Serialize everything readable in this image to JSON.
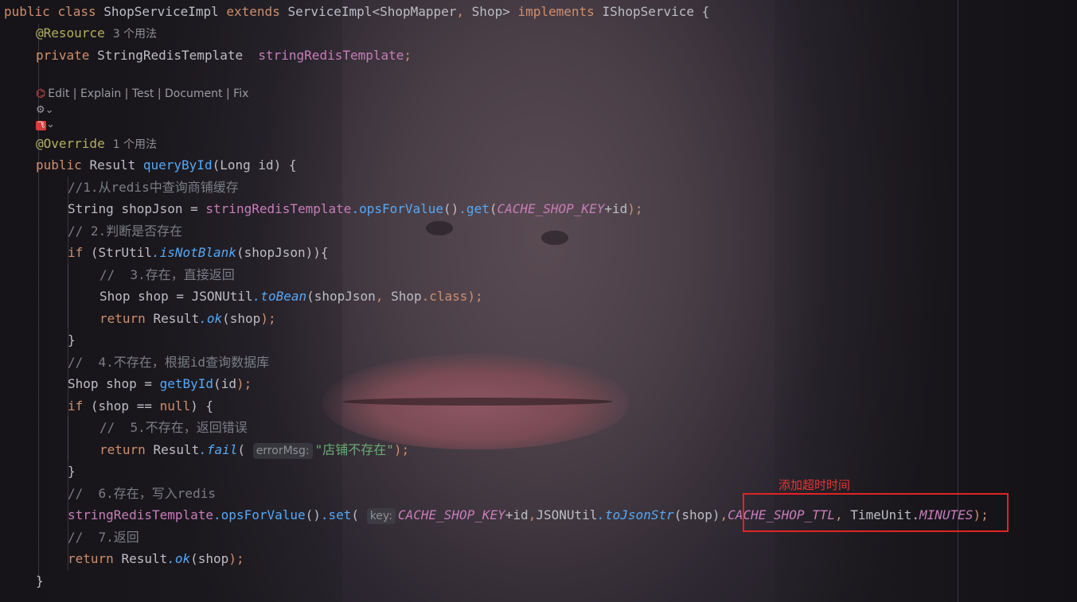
{
  "code": {
    "class_decl": {
      "kw1": "public",
      "kw2": "class",
      "name": "ShopServiceImpl",
      "kw3": "extends",
      "parent": "ServiceImpl",
      "lt": "<",
      "t1": "ShopMapper",
      "comma": ", ",
      "t2": "Shop",
      "gt": ">",
      "kw4": "implements",
      "iface": "IShopService",
      "brace": " {"
    },
    "field1_ann": "@Resource",
    "field1_usage": "3 个用法",
    "field1": {
      "kw": "private",
      "type": "StringRedisTemplate",
      "name": "stringRedisTemplate",
      "semi": ";"
    },
    "ai_actions": "Edit | Explain | Test | Document | Fix",
    "ai_logo": "⌬",
    "gutter1": "⚙",
    "gutter2_badge": "飞",
    "chevron": "⌄",
    "method_ann": "@Override",
    "method_usage": "1 个用法",
    "method_sig": {
      "kw": "public",
      "type": "Result",
      "name": "queryById",
      "open": "(",
      "ptype": "Long",
      "pname": "id",
      "close": ")",
      "brace": " {"
    },
    "c1": "//1.从redis中查询商铺缓存",
    "l_get": {
      "type": "String",
      "var": "shopJson",
      "eq": " = ",
      "tmpl": "stringRedisTemplate",
      "m1": ".opsForValue",
      "p1": "()",
      "m2": ".get",
      "open": "(",
      "const": "CACHE_SHOP_KEY",
      "plus": "+",
      "arg": "id",
      "close": ");"
    },
    "c2": "// 2.判断是否存在",
    "l_if1": {
      "kw": "if",
      "open": " (",
      "cls": "StrUtil",
      "m": ".isNotBlank",
      "p": "(",
      "arg": "shopJson",
      "close": "))",
      "brace": "{"
    },
    "c3": "//  3.存在，直接返回",
    "l_tobean": {
      "type": "Shop",
      "var": "shop",
      "eq": " = ",
      "cls": "JSONUtil",
      "m": ".toBean",
      "open": "(",
      "a1": "shopJson",
      "comma": ", ",
      "a2": "Shop",
      "cls_kw": ".class",
      "close": ");"
    },
    "l_ret1": {
      "kw": "return",
      "cls": "Result",
      "m": ".ok",
      "open": "(",
      "arg": "shop",
      "close": ");"
    },
    "brace_close": "}",
    "c4": "//  4.不存在，根据id查询数据库",
    "l_getbyid": {
      "type": "Shop",
      "var": "shop",
      "eq": " = ",
      "m": "getById",
      "open": "(",
      "arg": "id",
      "close": ");"
    },
    "l_if2": {
      "kw": "if",
      "open": " (",
      "var": "shop",
      "op": " == ",
      "null": "null",
      "close": ")",
      "brace": " {"
    },
    "c5": "//  5.不存在，返回错误",
    "l_ret2": {
      "kw": "return",
      "cls": "Result",
      "m": ".fail",
      "open": "(",
      "inlay": "errorMsg:",
      "str": "\"店铺不存在\"",
      "close": ");"
    },
    "c6": "//  6.存在，写入redis",
    "l_set": {
      "tmpl": "stringRedisTemplate",
      "m1": ".opsForValue",
      "p1": "()",
      "m2": ".set",
      "open": "(",
      "inlay": "key:",
      "const": "CACHE_SHOP_KEY",
      "plus": "+",
      "arg": "id",
      "comma": ",",
      "cls": "JSONUtil",
      "m3": ".toJsonStr",
      "open2": "(",
      "arg2": "shop",
      "close2": ")",
      "comma2": ",",
      "ttl": "CACHE_SHOP_TTL",
      "comma3": ", ",
      "tu": "TimeUnit",
      "dot": ".",
      "min": "MINUTES",
      "close": ");"
    },
    "c7": "//  7.返回",
    "l_ret3": {
      "kw": "return",
      "cls": "Result",
      "m": ".ok",
      "open": "(",
      "arg": "shop",
      "close": ");"
    },
    "method_close": "}"
  },
  "annotation_note": "添加超时时间",
  "colors": {
    "keyword": "#cf8e6d",
    "annotation": "#b3ae60",
    "comment": "#7a7e85",
    "string": "#6aab73",
    "constant": "#c77dbb",
    "function": "#56a8f5",
    "highlight": "#e02424"
  }
}
